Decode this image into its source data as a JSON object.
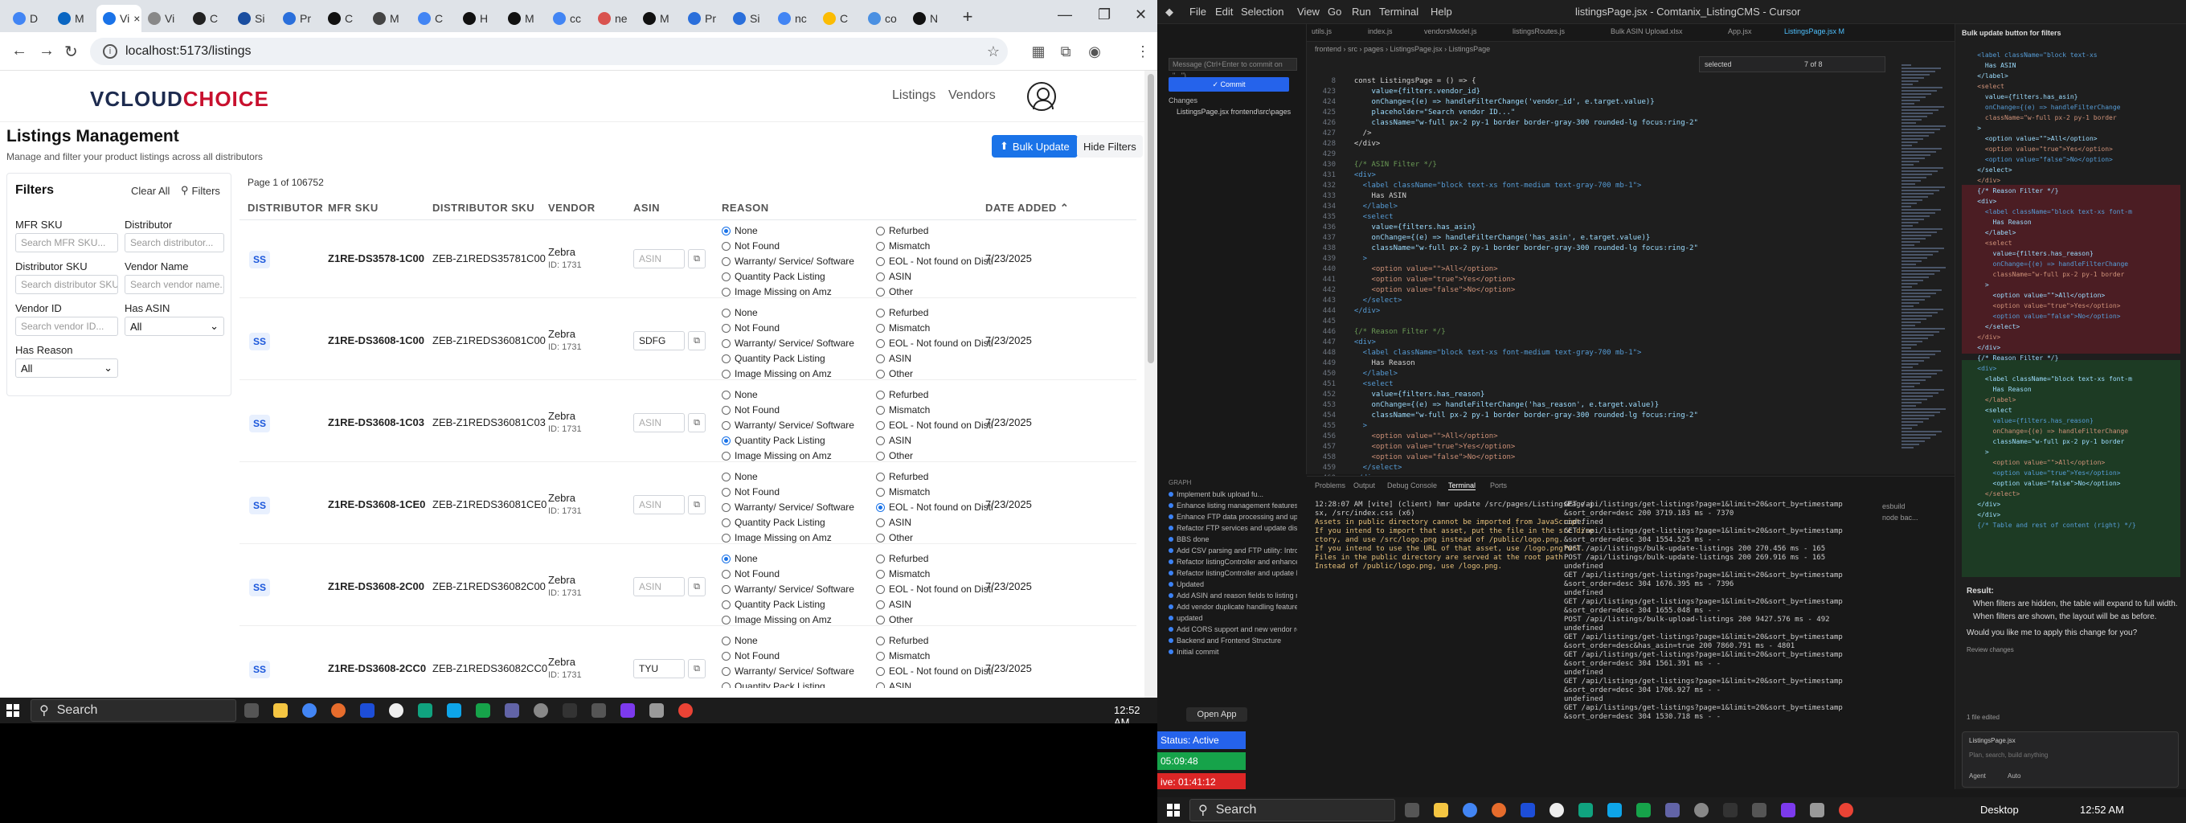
{
  "browser": {
    "tabs": [
      {
        "label": "D",
        "color": "#4285f4"
      },
      {
        "label": "M",
        "color": "#0a66c2"
      },
      {
        "label": "Vi",
        "color": "#1a73e8",
        "active": true
      },
      {
        "label": "Vi",
        "color": "#888888"
      },
      {
        "label": "C",
        "color": "#222222"
      },
      {
        "label": "Si",
        "color": "#1a4ea0"
      },
      {
        "label": "Pr",
        "color": "#2a6fdb"
      },
      {
        "label": "C",
        "color": "#111111"
      },
      {
        "label": "M",
        "color": "#444444"
      },
      {
        "label": "C",
        "color": "#4285f4"
      },
      {
        "label": "H",
        "color": "#111111"
      },
      {
        "label": "M",
        "color": "#111111"
      },
      {
        "label": "cc",
        "color": "#4285f4"
      },
      {
        "label": "ne",
        "color": "#d9534f"
      },
      {
        "label": "M",
        "color": "#111111"
      },
      {
        "label": "Pr",
        "color": "#2a6fdb"
      },
      {
        "label": "Si",
        "color": "#2a6fdb"
      },
      {
        "label": "nc",
        "color": "#4285f4"
      },
      {
        "label": "C",
        "color": "#fbbc04"
      },
      {
        "label": "co",
        "color": "#4a90e2"
      },
      {
        "label": "N",
        "color": "#111111"
      }
    ],
    "url": "localhost:5173/listings"
  },
  "app": {
    "logo_main": "VCLOUD",
    "logo_accent": "CHOICE",
    "nav": [
      "Listings",
      "Vendors"
    ],
    "title": "Listings Management",
    "subtitle": "Manage and filter your product listings across all distributors",
    "bulk_update": "Bulk Update",
    "hide_filters": "Hide Filters",
    "filters": {
      "heading": "Filters",
      "clear_all": "Clear All",
      "filters_btn": "Filters",
      "mfr_sku_label": "MFR SKU",
      "mfr_sku_ph": "Search MFR SKU...",
      "distributor_label": "Distributor",
      "distributor_ph": "Search distributor...",
      "dist_sku_label": "Distributor SKU",
      "dist_sku_ph": "Search distributor SKU...",
      "vendor_name_label": "Vendor Name",
      "vendor_name_ph": "Search vendor name...",
      "vendor_id_label": "Vendor ID",
      "vendor_id_ph": "Search vendor ID...",
      "has_asin_label": "Has ASIN",
      "has_asin_value": "All",
      "has_reason_label": "Has Reason",
      "has_reason_value": "All"
    },
    "page_info": "Page 1 of 106752",
    "columns": [
      "DISTRIBUTOR",
      "MFR SKU",
      "DISTRIBUTOR SKU",
      "VENDOR",
      "ASIN",
      "REASON",
      "DATE ADDED ⌃"
    ],
    "reasons_left": [
      "None",
      "Not Found",
      "Warranty/ Service/ Software",
      "Quantity Pack Listing",
      "Image Missing on Amz"
    ],
    "reasons_right": [
      "Refurbed",
      "Mismatch",
      "EOL - Not found on Disti",
      "ASIN",
      "Other"
    ],
    "rows": [
      {
        "dist": "SS",
        "mfr": "Z1RE-DS3578-1C00",
        "dsku": "ZEB-Z1REDS35781C00",
        "vendor": "Zebra",
        "vid": "ID: 1731",
        "asin": "",
        "asin_ph": "ASIN",
        "selected": "None",
        "date": "7/23/2025"
      },
      {
        "dist": "SS",
        "mfr": "Z1RE-DS3608-1C00",
        "dsku": "ZEB-Z1REDS36081C00",
        "vendor": "Zebra",
        "vid": "ID: 1731",
        "asin": "SDFG",
        "asin_ph": "ASIN",
        "selected": "",
        "date": "7/23/2025"
      },
      {
        "dist": "SS",
        "mfr": "Z1RE-DS3608-1C03",
        "dsku": "ZEB-Z1REDS36081C03",
        "vendor": "Zebra",
        "vid": "ID: 1731",
        "asin": "",
        "asin_ph": "ASIN",
        "selected": "Quantity Pack Listing",
        "date": "7/23/2025"
      },
      {
        "dist": "SS",
        "mfr": "Z1RE-DS3608-1CE0",
        "dsku": "ZEB-Z1REDS36081CE0",
        "vendor": "Zebra",
        "vid": "ID: 1731",
        "asin": "",
        "asin_ph": "ASIN",
        "selected": "EOL - Not found on Disti",
        "date": "7/23/2025"
      },
      {
        "dist": "SS",
        "mfr": "Z1RE-DS3608-2C00",
        "dsku": "ZEB-Z1REDS36082C00",
        "vendor": "Zebra",
        "vid": "ID: 1731",
        "asin": "",
        "asin_ph": "ASIN",
        "selected": "None",
        "date": "7/23/2025"
      },
      {
        "dist": "SS",
        "mfr": "Z1RE-DS3608-2CC0",
        "dsku": "ZEB-Z1REDS36082CC0",
        "vendor": "Zebra",
        "vid": "ID: 1731",
        "asin": "TYU",
        "asin_ph": "ASIN",
        "selected": "",
        "date": "7/23/2025"
      }
    ]
  },
  "taskbar_left": {
    "search": "Search",
    "clock": "12:52 AM"
  },
  "cursor": {
    "menus": [
      "File",
      "Edit",
      "Selection",
      "View",
      "Go",
      "Run",
      "Terminal",
      "Help"
    ],
    "window_title": "listingsPage.jsx - Comtanix_ListingCMS - Cursor",
    "tabs": [
      "utils.js",
      "index.js",
      "vendorsModel.js",
      "listingsRoutes.js",
      "Bulk ASIN Upload.xlsx",
      "App.jsx",
      "ListingsPage.jsx M",
      "Bulk update button for filters"
    ],
    "breadcrumb": "frontend › src › pages › ListingsPage.jsx › ListingsPage",
    "find": "selected",
    "find_count": "7 of 8",
    "msg_placeholder": "Message (Ctrl+Enter to commit on \"...\")",
    "commit": "✓ Commit",
    "changes": "Changes",
    "changed_file": "ListingsPage.jsx  frontend\\src\\pages",
    "graph_label": "GRAPH",
    "graph_items": [
      "Implement bulk upload fu...",
      "Enhance listing management features",
      "Enhance FTP data processing and upda...",
      "Refactor FTP services and update distri...",
      "BBS done",
      "Add CSV parsing and FTP utility: Introd...",
      "Refactor listingController and enhance ...",
      "Refactor listingController and update F...",
      "Updated",
      "Add ASIN and reason fields to listing m...",
      "Add vendor duplicate handling features ...",
      "updated",
      "Add CORS support and new vendor rou...",
      "Backend and Frontend Structure",
      "Initial commit"
    ],
    "panel_tabs": [
      "Problems",
      "Output",
      "Debug Console",
      "Terminal",
      "Ports"
    ],
    "terminal_left": [
      "12:28:07 AM [vite] (client) hmr update /src/pages/ListingsPage.j",
      "sx, /src/index.css (x6)",
      "Assets in public directory cannot be imported from JavaScript.",
      "If you intend to import that asset, put the file in the src dire",
      "ctory, and use /src/logo.png instead of /public/logo.png.",
      "If you intend to use the URL of that asset, use /logo.png?url.",
      "Files in the public directory are served at the root path.",
      "Instead of /public/logo.png, use /logo.png."
    ],
    "terminal_right": [
      "GET /api/listings/get-listings?page=1&limit=20&sort_by=timestamp",
      "&sort_order=desc 200 3719.183 ms - 7370",
      "undefined",
      "GET /api/listings/get-listings?page=1&limit=20&sort_by=timestamp",
      "&sort_order=desc 304 1554.525 ms - -",
      "POST /api/listings/bulk-update-listings 200 270.456 ms - 165",
      "POST /api/listings/bulk-update-listings 200 269.916 ms - 165",
      "undefined",
      "GET /api/listings/get-listings?page=1&limit=20&sort_by=timestamp",
      "&sort_order=desc 304 1676.395 ms - 7396",
      "undefined",
      "GET /api/listings/get-listings?page=1&limit=20&sort_by=timestamp",
      "&sort_order=desc 304 1655.048 ms - -",
      "POST /api/listings/bulk-upload-listings 200 9427.576 ms - 492",
      "undefined",
      "GET /api/listings/get-listings?page=1&limit=20&sort_by=timestamp",
      "&sort_order=desc&has_asin=true 200 7860.791 ms - 4801",
      "GET /api/listings/get-listings?page=1&limit=20&sort_by=timestamp",
      "&sort_order=desc 304 1561.391 ms - -",
      "undefined",
      "GET /api/listings/get-listings?page=1&limit=20&sort_by=timestamp",
      "&sort_order=desc 304 1706.927 ms - -",
      "undefined",
      "GET /api/listings/get-listings?page=1&limit=20&sort_by=timestamp",
      "&sort_order=desc 304 1530.718 ms - -"
    ],
    "terminal_sessions": [
      "esbuild",
      "node bac..."
    ],
    "chat_title": "Bulk update button for filters",
    "result_label": "Result:",
    "result_lines": [
      "When filters are hidden, the table will expand to full width.",
      "When filters are shown, the layout will be as before."
    ],
    "result_question": "Would you like me to apply this change for you?",
    "review_changes": "Review changes",
    "chat_file": "1 file edited",
    "chat_file_name": "ListingsPage.jsx",
    "chat_placeholder": "Plan, search, build anything",
    "agent_mode": "Agent",
    "auto_mode": "Auto",
    "status_active": "Status: Active",
    "timer1": "05:09:48",
    "timer2": "ive: 01:41:12",
    "open_app": "Open App",
    "search": "Search",
    "desktop": "Desktop",
    "clock": "12:52 AM"
  }
}
